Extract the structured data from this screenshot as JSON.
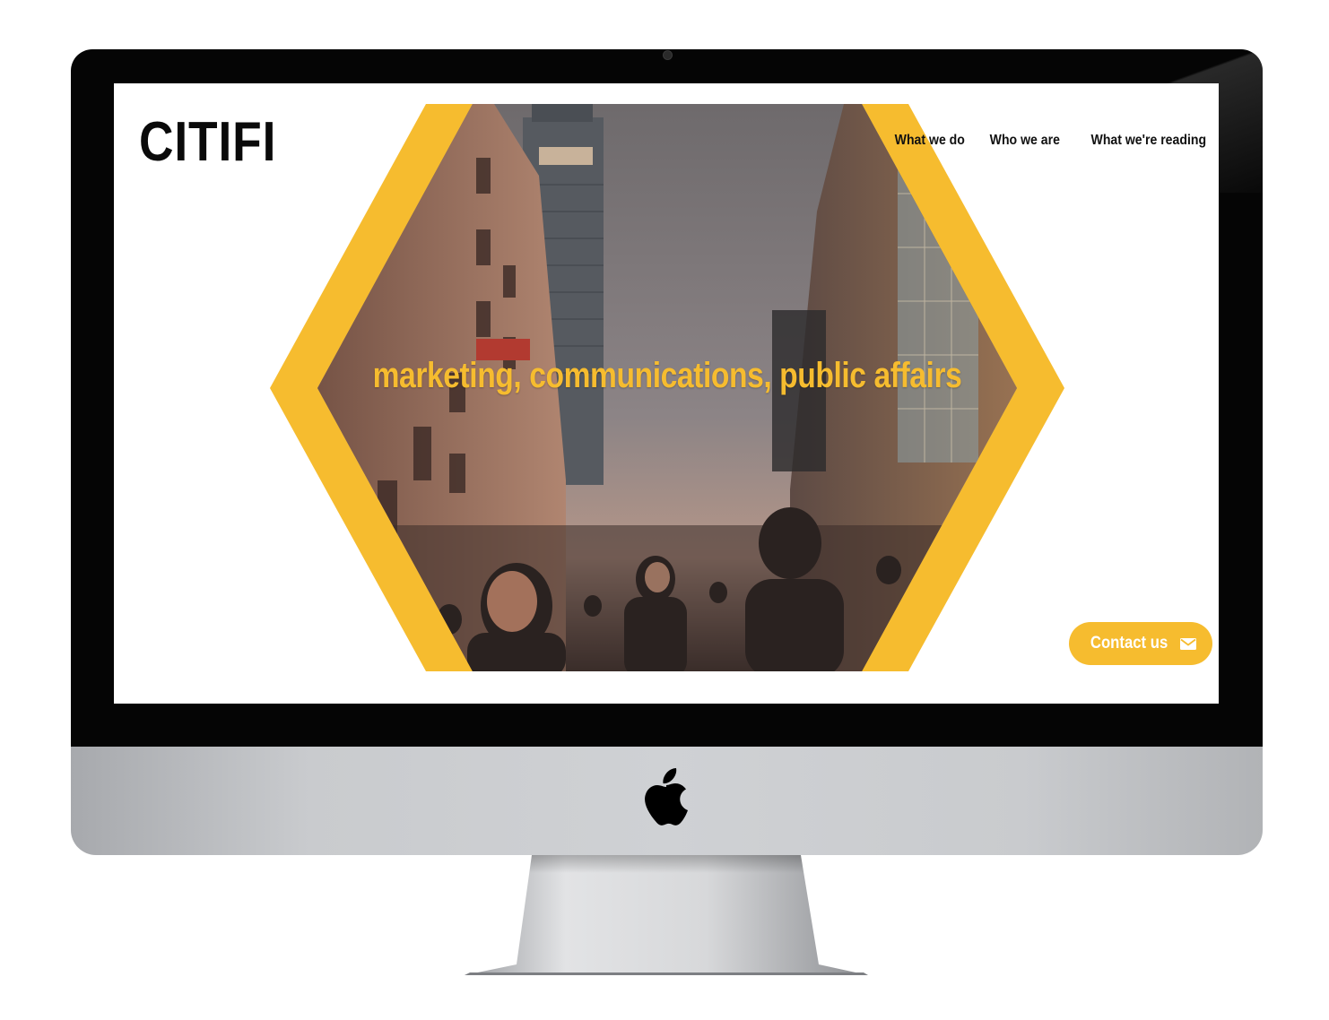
{
  "site": {
    "logo": "CITIFI",
    "nav": [
      {
        "label": "What we do"
      },
      {
        "label": "Who we are"
      },
      {
        "label": "What we're reading"
      }
    ],
    "hero": {
      "tagline": "marketing, communications, public affairs"
    },
    "contact_button": {
      "label": "Contact us",
      "icon": "envelope-icon"
    }
  },
  "device": {
    "type": "imac",
    "logo_icon": "apple-logo-icon"
  },
  "colors": {
    "accent": "#f6bc2f",
    "text": "#0a0a0a",
    "bezel": "#050505",
    "chin": "#cfd1d4"
  }
}
